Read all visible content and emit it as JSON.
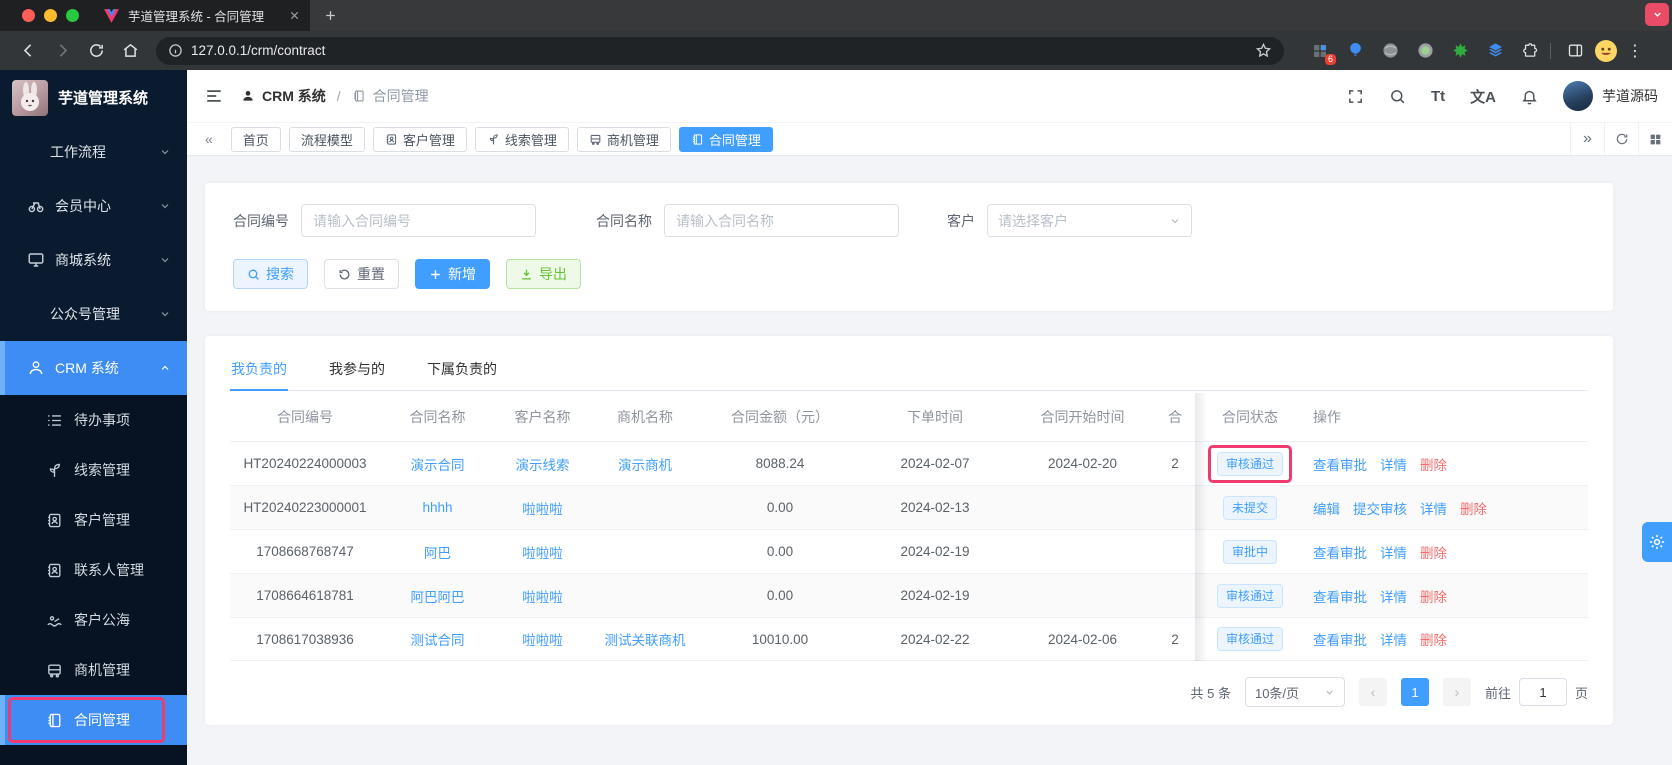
{
  "browser": {
    "tab_title": "芋道管理系统 - 合同管理",
    "url": "127.0.0.1/crm/contract",
    "extension_badge": "6"
  },
  "app_header": {
    "breadcrumb_root": "CRM 系统",
    "breadcrumb_separator": "/",
    "breadcrumb_current": "合同管理",
    "font_size_icon_label": "Tt",
    "translate_icon_label": "文A",
    "username": "芋道源码"
  },
  "sidebar": {
    "title": "芋道管理系统",
    "groups": [
      {
        "label": "工作流程",
        "icon": ""
      },
      {
        "label": "会员中心",
        "icon": "member"
      },
      {
        "label": "商城系统",
        "icon": "mall"
      },
      {
        "label": "公众号管理",
        "icon": ""
      },
      {
        "label": "CRM 系统",
        "icon": "person"
      }
    ],
    "children": [
      {
        "label": "待办事项",
        "icon": "todo"
      },
      {
        "label": "线索管理",
        "icon": "clue"
      },
      {
        "label": "客户管理",
        "icon": "contact"
      },
      {
        "label": "联系人管理",
        "icon": "contact"
      },
      {
        "label": "客户公海",
        "icon": "sea"
      },
      {
        "label": "商机管理",
        "icon": "bus"
      },
      {
        "label": "合同管理",
        "icon": "notebook"
      }
    ]
  },
  "tags_view": {
    "tabs": [
      {
        "label": "首页",
        "icon": ""
      },
      {
        "label": "流程模型",
        "icon": ""
      },
      {
        "label": "客户管理",
        "icon": "contact"
      },
      {
        "label": "线索管理",
        "icon": "clue"
      },
      {
        "label": "商机管理",
        "icon": "bus"
      },
      {
        "label": "合同管理",
        "icon": "notebook"
      }
    ]
  },
  "filters": {
    "contract_no_label": "合同编号",
    "contract_no_placeholder": "请输入合同编号",
    "contract_name_label": "合同名称",
    "contract_name_placeholder": "请输入合同名称",
    "customer_label": "客户",
    "customer_placeholder": "请选择客户",
    "search_label": "搜索",
    "reset_label": "重置",
    "add_label": "新增",
    "export_label": "导出"
  },
  "table": {
    "tabs": [
      "我负责的",
      "我参与的",
      "下属负责的"
    ],
    "headers": [
      "合同编号",
      "合同名称",
      "客户名称",
      "商机名称",
      "合同金额（元）",
      "下单时间",
      "合同开始时间",
      "合",
      "合同状态",
      "操作"
    ],
    "rows": [
      {
        "code": "HT20240224000003",
        "name": "演示合同",
        "customer": "演示线索",
        "business": "演示商机",
        "amount": "8088.24",
        "order_time": "2024-02-07",
        "start_time": "2024-02-20",
        "trunc": "2",
        "status": "审核通过",
        "actions": [
          "查看审批",
          "详情",
          "删除"
        ]
      },
      {
        "code": "HT20240223000001",
        "name": "hhhh",
        "customer": "啦啦啦",
        "business": "",
        "amount": "0.00",
        "order_time": "2024-02-13",
        "start_time": "",
        "trunc": "",
        "status": "未提交",
        "actions": [
          "编辑",
          "提交审核",
          "详情",
          "删除"
        ]
      },
      {
        "code": "1708668768747",
        "name": "阿巴",
        "customer": "啦啦啦",
        "business": "",
        "amount": "0.00",
        "order_time": "2024-02-19",
        "start_time": "",
        "trunc": "",
        "status": "审批中",
        "actions": [
          "查看审批",
          "详情",
          "删除"
        ]
      },
      {
        "code": "1708664618781",
        "name": "阿巴阿巴",
        "customer": "啦啦啦",
        "business": "",
        "amount": "0.00",
        "order_time": "2024-02-19",
        "start_time": "",
        "trunc": "",
        "status": "审核通过",
        "actions": [
          "查看审批",
          "详情",
          "删除"
        ]
      },
      {
        "code": "1708617038936",
        "name": "测试合同",
        "customer": "啦啦啦",
        "business": "测试关联商机",
        "amount": "10010.00",
        "order_time": "2024-02-22",
        "start_time": "2024-02-06",
        "trunc": "2",
        "status": "审核通过",
        "actions": [
          "查看审批",
          "详情",
          "删除"
        ]
      }
    ]
  },
  "pagination": {
    "total": "共 5 条",
    "page_size": "10条/页",
    "current_page": "1",
    "goto_label": "前往",
    "goto_value": "1",
    "page_unit": "页"
  },
  "colors": {
    "primary": "#409eff",
    "danger": "#f56c6c",
    "success": "#67c23a",
    "sidebar_bg": "#0b1b2f",
    "annotation": "#ef3b6f"
  }
}
